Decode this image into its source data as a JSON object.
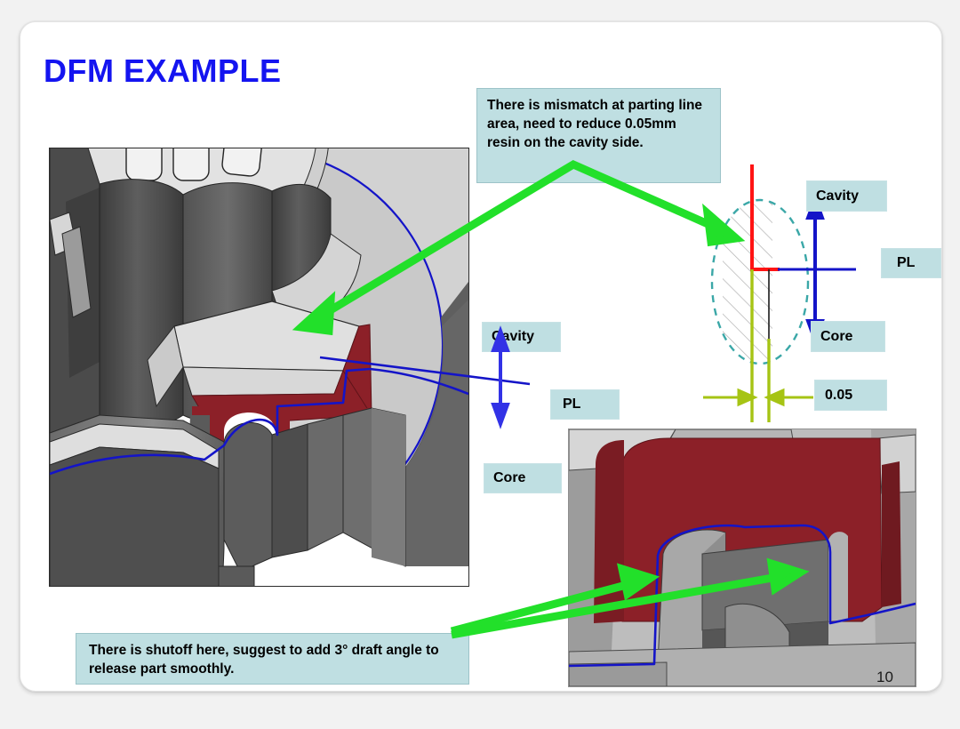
{
  "slide": {
    "title": "DFM EXAMPLE",
    "page_number": "10"
  },
  "callouts": {
    "mismatch": "There is mismatch at parting line area, need to reduce 0.05mm resin on the cavity side.",
    "shutoff": "There is shutoff here, suggest to add 3°  draft angle to release part smoothly."
  },
  "labels": {
    "cavity_left": "Cavity",
    "pl_left": "PL",
    "core_left": "Core",
    "cavity_right": "Cavity",
    "pl_right": "PL",
    "core_right": "Core",
    "dimension": "0.05"
  },
  "colors": {
    "title_blue": "#1414f0",
    "callout_fill": "#bfdfe2",
    "arrow_green": "#22e02a",
    "parting_line_blue": "#1414c8",
    "resin_red": "#8c2028",
    "dim_yellow_green": "#a6c414",
    "section_red": "#ff1414",
    "ellipse_teal": "#3aa7a7"
  },
  "figures": {
    "main_render": "cad-part-section-view",
    "detail_render": "cad-shutoff-closeup-view",
    "section_diagram": "parting-line-mismatch-cross-section"
  }
}
